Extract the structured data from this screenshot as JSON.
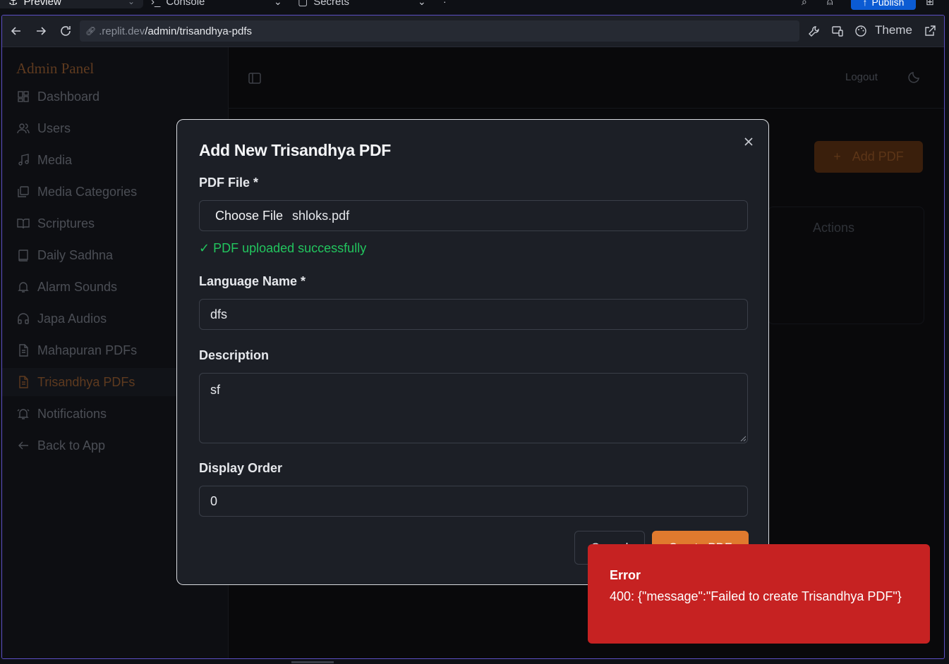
{
  "ide": {
    "tabs": [
      {
        "label": "Preview"
      },
      {
        "label": "Console"
      },
      {
        "label": "Secrets"
      }
    ],
    "publish_label": "Publish"
  },
  "browser": {
    "url_host": ".replit.dev",
    "url_path": "/admin/trisandhya-pdfs",
    "theme_label": "Theme"
  },
  "sidebar": {
    "brand": "Admin Panel",
    "items": [
      {
        "label": "Dashboard",
        "icon": "dashboard-icon"
      },
      {
        "label": "Users",
        "icon": "users-icon"
      },
      {
        "label": "Media",
        "icon": "music-icon"
      },
      {
        "label": "Media Categories",
        "icon": "library-icon"
      },
      {
        "label": "Scriptures",
        "icon": "book-open-icon"
      },
      {
        "label": "Daily Sadhna",
        "icon": "book-icon"
      },
      {
        "label": "Alarm Sounds",
        "icon": "bell-icon"
      },
      {
        "label": "Japa Audios",
        "icon": "headphones-icon"
      },
      {
        "label": "Mahapuran PDFs",
        "icon": "file-text-icon"
      },
      {
        "label": "Trisandhya PDFs",
        "icon": "file-text-icon",
        "active": true
      },
      {
        "label": "Notifications",
        "icon": "bell-ring-icon"
      },
      {
        "label": "Back to App",
        "icon": "arrow-left-icon"
      }
    ]
  },
  "header": {
    "logout_label": "Logout"
  },
  "page": {
    "add_pdf_label": "Add PDF",
    "actions_header": "Actions"
  },
  "modal": {
    "title": "Add New Trisandhya PDF",
    "pdf_file_label": "PDF File *",
    "choose_file_label": "Choose File",
    "file_name": "shloks.pdf",
    "upload_status": "✓ PDF uploaded successfully",
    "language_label": "Language Name *",
    "language_value": "dfs",
    "description_label": "Description",
    "description_value": "sf",
    "order_label": "Display Order",
    "order_value": "0",
    "cancel_label": "Cancel",
    "create_label": "Create PDF"
  },
  "toast": {
    "title": "Error",
    "message": "400: {\"message\":\"Failed to create Trisandhya PDF\"}"
  },
  "colors": {
    "accent": "#e07a2e",
    "success": "#22c55e",
    "error": "#c62222",
    "frame_border": "#5c4fc4"
  }
}
